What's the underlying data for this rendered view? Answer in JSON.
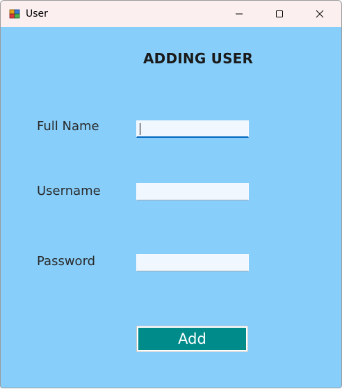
{
  "window": {
    "title": "User",
    "icon": "app-window-icon",
    "controls": {
      "minimize": "minimize-icon",
      "maximize": "maximize-icon",
      "close": "close-icon"
    }
  },
  "form": {
    "heading": "ADDING USER",
    "fields": [
      {
        "label": "Full Name",
        "value": ""
      },
      {
        "label": "Username",
        "value": ""
      },
      {
        "label": "Password",
        "value": ""
      }
    ],
    "submit_label": "Add"
  },
  "colors": {
    "background": "#87cefa",
    "titlebar": "#fcefef",
    "button": "#008b8b",
    "focus_underline": "#0067c0"
  }
}
